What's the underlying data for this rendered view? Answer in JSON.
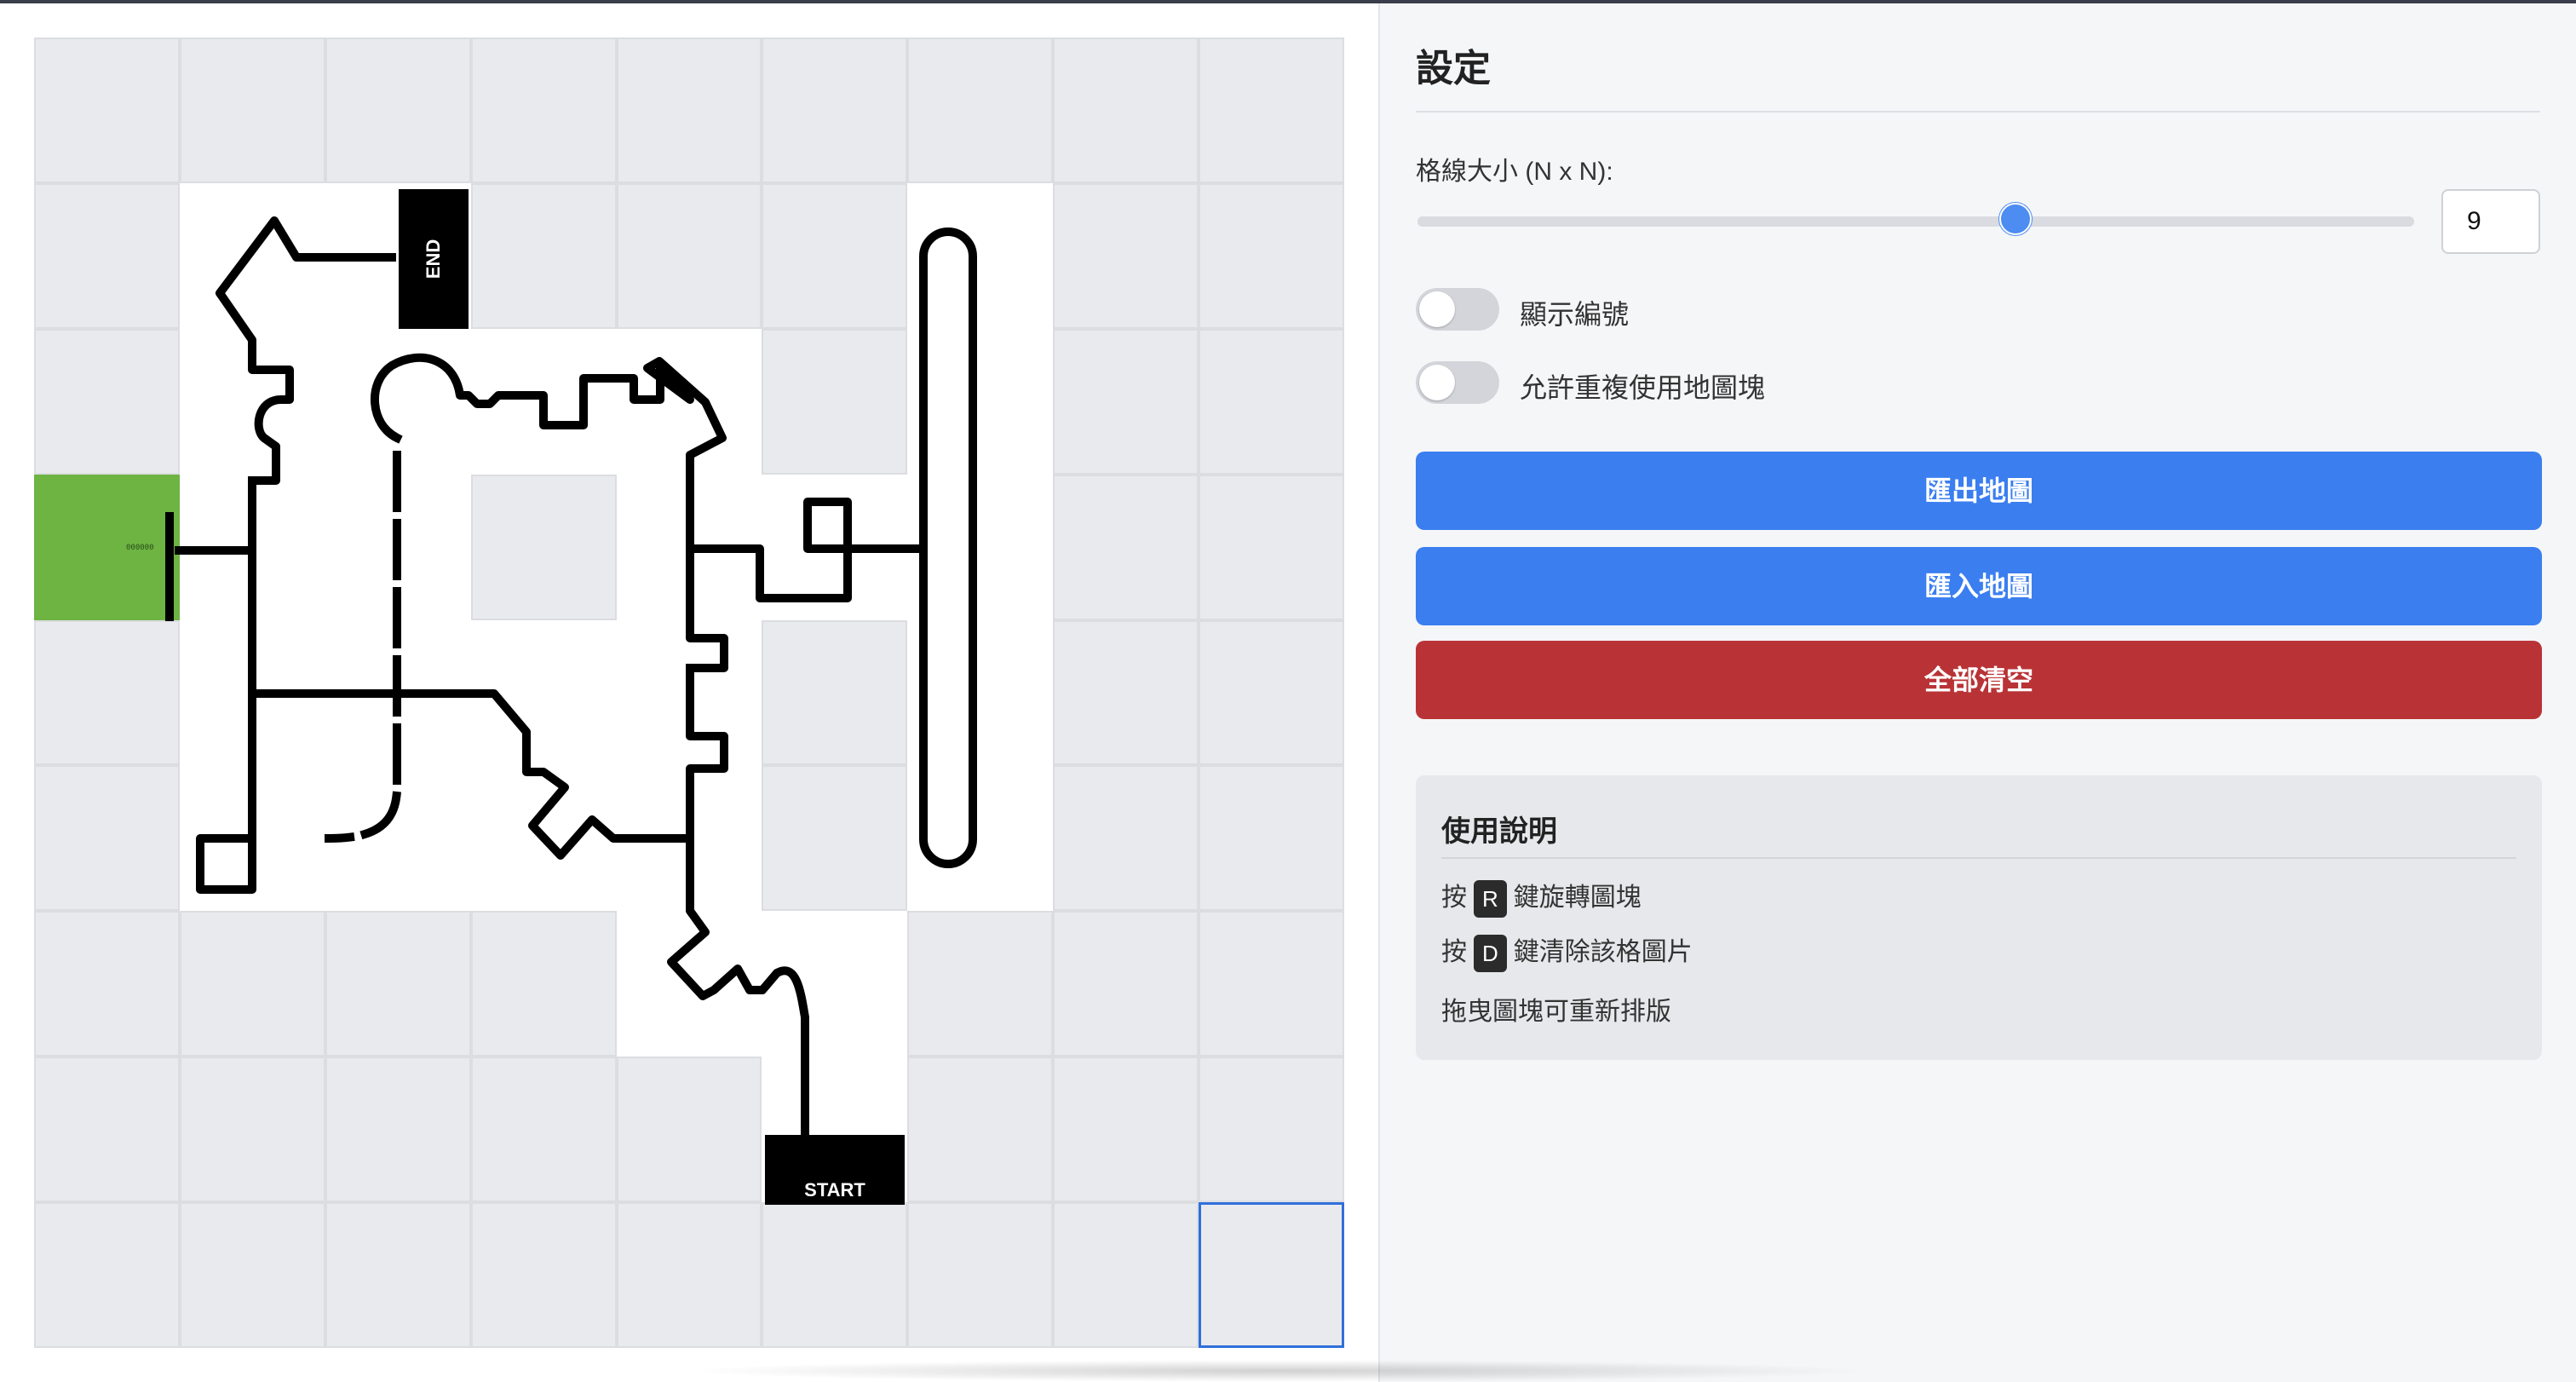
{
  "grid": {
    "size": 9,
    "start_label": "START",
    "end_label": "END",
    "green_tile_label": "000000"
  },
  "settings": {
    "title": "設定",
    "grid_size_label": "格線大小 (N x N):",
    "grid_size_value": "9",
    "slider_value_fraction": 0.6,
    "toggle_show_numbers": {
      "label": "顯示編號",
      "on": false
    },
    "toggle_allow_reuse": {
      "label": "允許重複使用地圖塊",
      "on": false
    },
    "export_button": "匯出地圖",
    "import_button": "匯入地圖",
    "clear_button": "全部清空",
    "accent_color": "#3a7ef0",
    "danger_color": "#b93336"
  },
  "help": {
    "title": "使用說明",
    "line1_prefix": "按",
    "line1_key": "R",
    "line1_text": "鍵旋轉圖塊",
    "line2_prefix": "按",
    "line2_key": "D",
    "line2_text": "鍵清除該格圖片",
    "line3_text": "拖曳圖塊可重新排版"
  }
}
